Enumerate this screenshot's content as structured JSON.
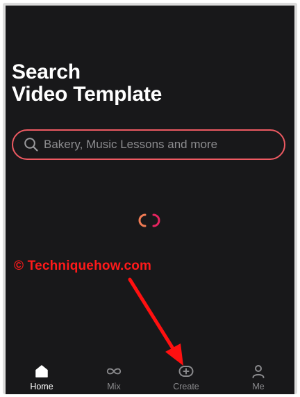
{
  "page": {
    "title_line1": "Search",
    "title_line2": "Video Template"
  },
  "search": {
    "placeholder": "Bakery, Music Lessons and more",
    "icon": "search-icon"
  },
  "loading": {
    "icon": "loading-spinner-icon",
    "colors": [
      "#f07b54",
      "#e5245f"
    ]
  },
  "watermark": {
    "text": "© Techniquehow.com",
    "color": "#ff1a1a"
  },
  "annotation": {
    "icon": "red-arrow-icon",
    "points_to": "Create"
  },
  "bottom_nav": {
    "items": [
      {
        "label": "Home",
        "icon": "home-icon",
        "active": true
      },
      {
        "label": "Mix",
        "icon": "infinity-icon",
        "active": false
      },
      {
        "label": "Create",
        "icon": "create-plus-icon",
        "active": false
      },
      {
        "label": "Me",
        "icon": "person-icon",
        "active": false
      }
    ]
  },
  "colors": {
    "background": "#18181a",
    "accent": "#ee5a62",
    "text": "#ffffff",
    "muted": "#8a8a8d"
  }
}
